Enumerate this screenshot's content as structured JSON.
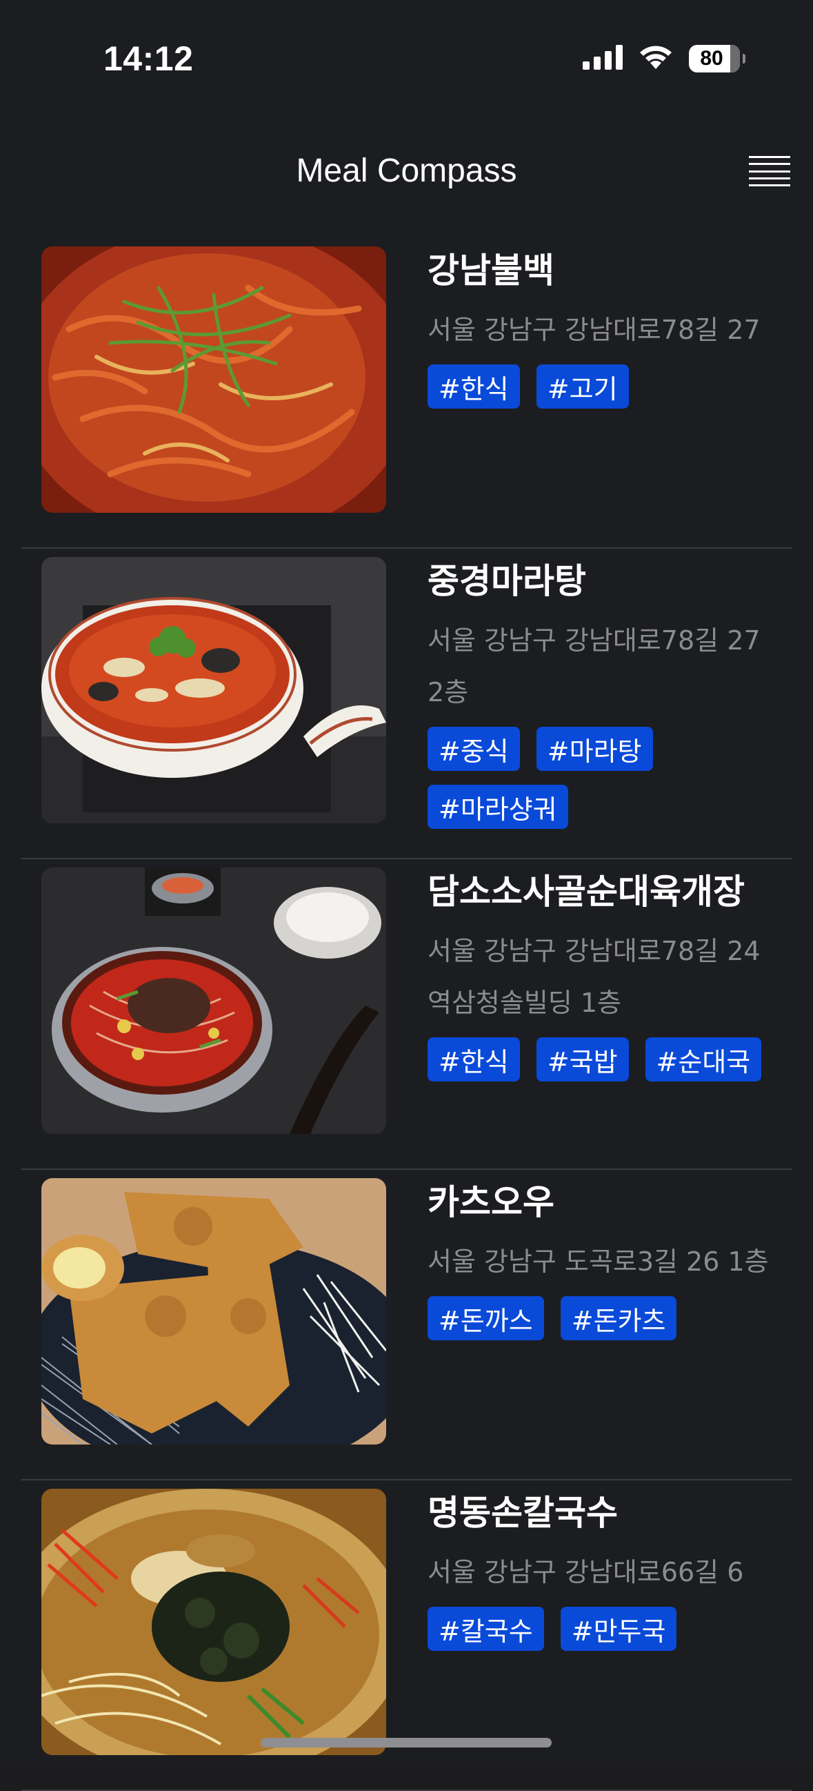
{
  "status_bar": {
    "time": "14:12",
    "battery": "80"
  },
  "header": {
    "title": "Meal Compass"
  },
  "restaurants": [
    {
      "name": "강남불백",
      "address": "서울 강남구 강남대로78길 27",
      "tags": [
        "#한식",
        "#고기"
      ]
    },
    {
      "name": "중경마라탕",
      "address": "서울 강남구 강남대로78길 27 2층",
      "tags": [
        "#중식",
        "#마라탕",
        "#마라샹궈"
      ]
    },
    {
      "name": "담소소사골순대육개장",
      "address": "서울 강남구 강남대로78길 24 역삼청솔빌딩 1층",
      "tags": [
        "#한식",
        "#국밥",
        "#순대국"
      ]
    },
    {
      "name": "카츠오우",
      "address": "서울 강남구 도곡로3길 26 1층",
      "tags": [
        "#돈까스",
        "#돈카츠"
      ]
    },
    {
      "name": "명동손칼국수",
      "address": "서울 강남구 강남대로66길 6",
      "tags": [
        "#칼국수",
        "#만두국"
      ]
    }
  ],
  "colors": {
    "background": "#1c1d20",
    "tag_background": "#0a4ad9",
    "address_text": "#8b8c90"
  }
}
